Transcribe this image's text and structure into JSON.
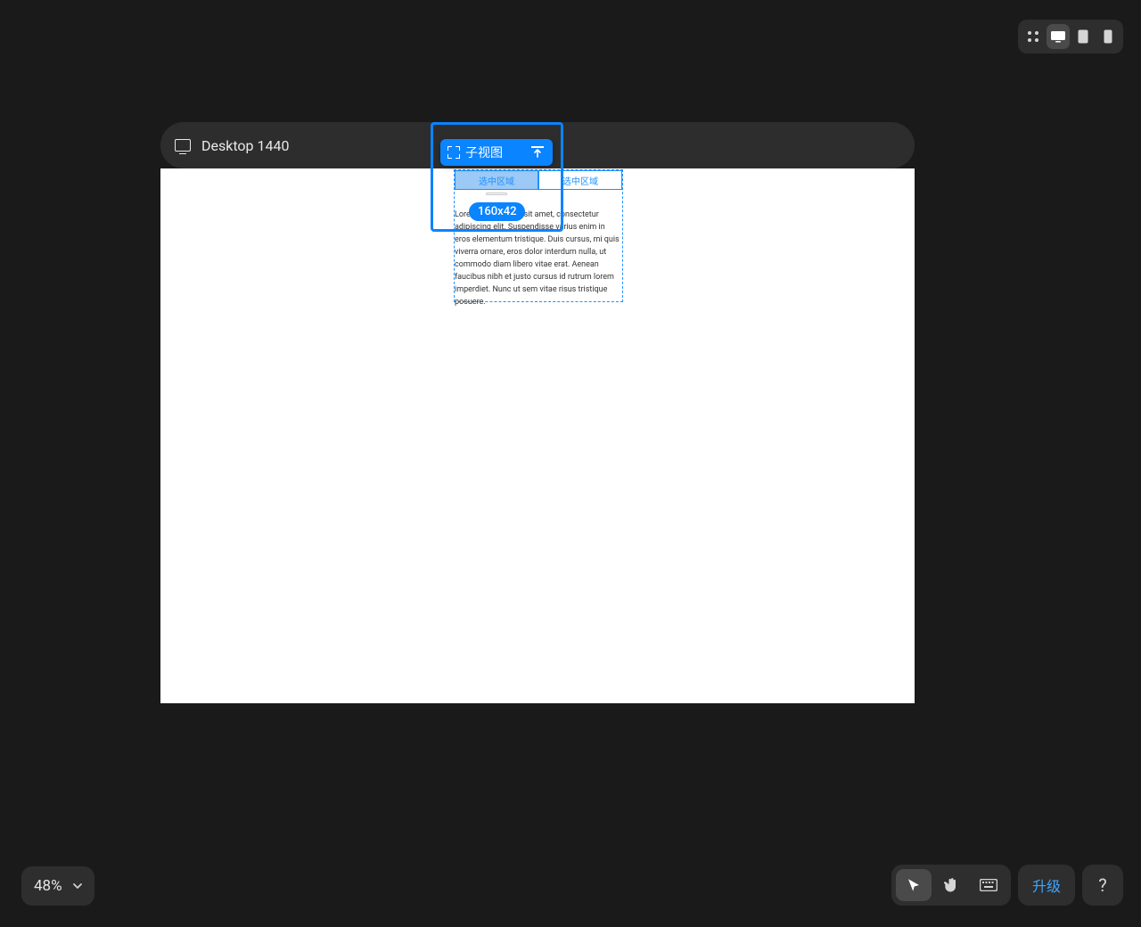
{
  "breakpoint": {
    "label": "Desktop 1440"
  },
  "selection": {
    "element_label": "子视图",
    "size_label": "160x42"
  },
  "tabs": {
    "active_label": "选中区域",
    "inactive_label": "选中区域"
  },
  "canvas_content": {
    "paragraph": "Lorem ipsum dolor sit amet, consectetur adipiscing elit. Suspendisse varius enim in eros elementum tristique. Duis cursus, mi quis viverra ornare, eros dolor interdum nulla, ut commodo diam libero vitae erat. Aenean faucibus nibh et justo cursus id rutrum lorem imperdiet. Nunc ut sem vitae risus tristique posuere."
  },
  "zoom": {
    "value": "48%"
  },
  "bottom_toolbar": {
    "upgrade_label": "升级",
    "help_label": "?"
  }
}
